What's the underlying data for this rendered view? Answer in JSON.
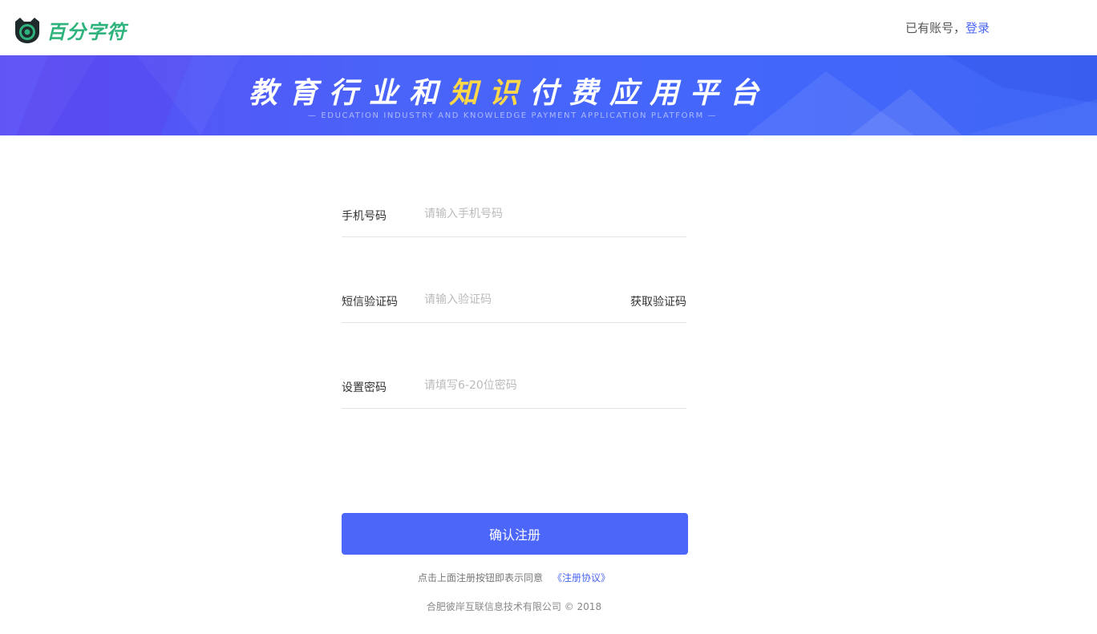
{
  "header": {
    "brand_name": "百分字符",
    "logo_icon": "cat-face-icon",
    "has_account_text": "已有账号，",
    "login_link": "登录"
  },
  "banner": {
    "title_part1": "教育行业和",
    "title_highlight": "知识",
    "title_part2": "付费应用平台",
    "subtitle": "— EDUCATION INDUSTRY AND KNOWLEDGE PAYMENT APPLICATION PLATFORM —"
  },
  "form": {
    "phone_label": "手机号码",
    "phone_placeholder": "请输入手机号码",
    "sms_label": "短信验证码",
    "sms_placeholder": "请输入验证码",
    "get_code_label": "获取验证码",
    "password_label": "设置密码",
    "password_placeholder": "请填写6-20位密码",
    "submit_label": "确认注册"
  },
  "agreement": {
    "text": "点击上面注册按钮即表示同意",
    "link": "《注册协议》"
  },
  "footer": {
    "copyright": "合肥彼岸互联信息技术有限公司 © 2018"
  },
  "colors": {
    "brand_green": "#2fb37c",
    "accent_blue": "#4c66f9",
    "link_blue": "#4a67f5",
    "highlight_yellow": "#ffd84a"
  }
}
